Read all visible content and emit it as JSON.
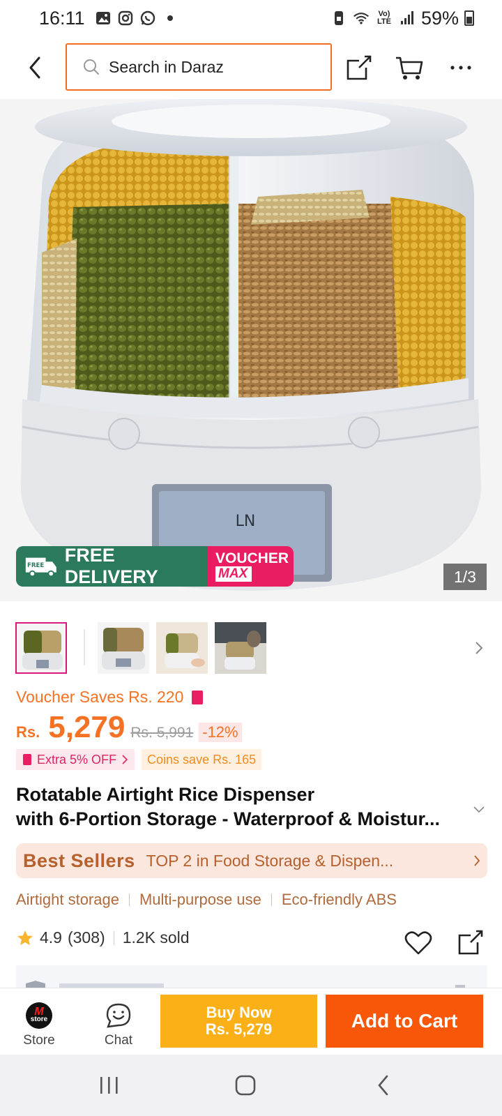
{
  "status_bar": {
    "time": "16:11",
    "network_label": "Vo) LTE",
    "battery": "59%"
  },
  "top_nav": {
    "search_placeholder": "Search in Daraz"
  },
  "gallery": {
    "counter": "1/3",
    "promo_free": "FREE DELIVERY",
    "promo_free_tag": "FREE",
    "promo_voucher": "VOUCHER",
    "promo_voucher_max": "MAX",
    "product_box_logo": "LN"
  },
  "pricing": {
    "voucher_saves": "Voucher Saves Rs. 220",
    "currency": "Rs.",
    "price": "5,279",
    "old_price": "Rs. 5,991",
    "discount": "-12%",
    "extra_off": "Extra 5% OFF",
    "coins_save": "Coins save Rs. 165"
  },
  "product": {
    "title_line1": "Rotatable Airtight Rice Dispenser",
    "title_line2": "with 6-Portion Storage - Waterproof & Moistur..."
  },
  "best_sellers": {
    "logo": "Best Sellers",
    "rank": "TOP 2 in Food Storage & Dispen..."
  },
  "features": [
    "Airtight storage",
    "Multi-purpose use",
    "Eco-friendly ABS"
  ],
  "rating": {
    "score": "4.9",
    "count": "(308)",
    "sold": "1.2K sold"
  },
  "action_bar": {
    "store_label": "Store",
    "store_logo_text": "store",
    "chat_label": "Chat",
    "buy_now_line1": "Buy Now",
    "buy_now_line2": "Rs. 5,279",
    "add_to_cart": "Add to Cart"
  },
  "colors": {
    "brand_orange": "#f57224",
    "add_to_cart_bg": "#f85608",
    "buy_now_bg": "#fbb018",
    "free_delivery_green": "#2b7a5b",
    "voucher_pink": "#ea1d63",
    "search_border": "#f26d21"
  },
  "icons": {
    "status_left": [
      "gallery-icon",
      "instagram-icon",
      "whatsapp-icon",
      "dot-icon"
    ],
    "status_right": [
      "phone-lock-icon",
      "wifi-icon",
      "lte-icon",
      "signal-icon",
      "battery-icon"
    ],
    "nav": [
      "back-icon",
      "search-icon",
      "share-icon",
      "cart-icon",
      "more-icon"
    ],
    "bottom": [
      "store-logo",
      "chat-icon"
    ],
    "system": [
      "recents-icon",
      "home-icon",
      "back-nav-icon"
    ]
  }
}
